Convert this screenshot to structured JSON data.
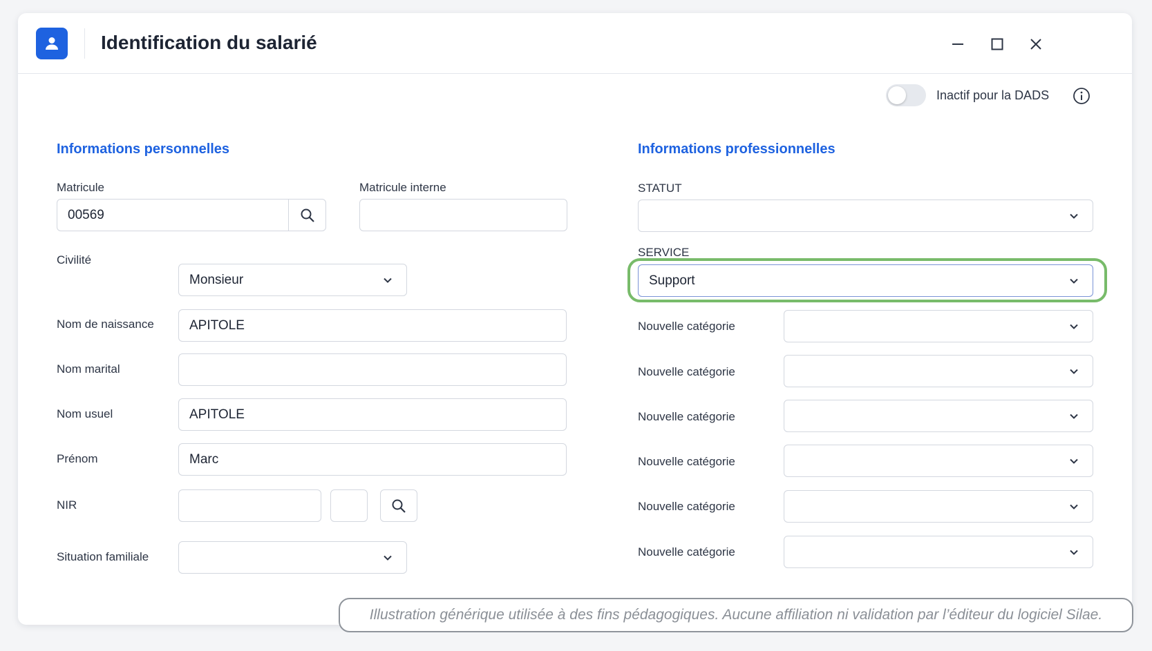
{
  "window": {
    "title": "Identification du salarié",
    "app_icon": "user-icon",
    "controls": [
      "minimize-icon",
      "maximize-icon",
      "close-icon"
    ]
  },
  "dads_toggle": {
    "label": "Inactif pour la DADS",
    "on": false,
    "info_icon": "info-icon"
  },
  "personal": {
    "title": "Informations personnelles",
    "matricule": {
      "label": "Matricule",
      "value": "00569"
    },
    "matricule_interne": {
      "label": "Matricule interne",
      "value": ""
    },
    "civilite": {
      "label": "Civilité",
      "value": "Monsieur"
    },
    "nom_naissance": {
      "label": "Nom de naissance",
      "value": "APITOLE"
    },
    "nom_marital": {
      "label": "Nom marital",
      "value": ""
    },
    "nom_usuel": {
      "label": "Nom usuel",
      "value": "APITOLE"
    },
    "prenom": {
      "label": "Prénom",
      "value": "Marc"
    },
    "nir": {
      "label": "NIR",
      "value": "",
      "key": ""
    },
    "situation_familiale": {
      "label": "Situation familiale",
      "value": ""
    }
  },
  "professional": {
    "title": "Informations professionnelles",
    "statut": {
      "label": "STATUT",
      "value": ""
    },
    "service": {
      "label": "SERVICE",
      "value": "Support"
    },
    "categories": [
      {
        "label": "Nouvelle catégorie",
        "value": ""
      },
      {
        "label": "Nouvelle catégorie",
        "value": ""
      },
      {
        "label": "Nouvelle catégorie",
        "value": ""
      },
      {
        "label": "Nouvelle catégorie",
        "value": ""
      },
      {
        "label": "Nouvelle catégorie",
        "value": ""
      },
      {
        "label": "Nouvelle catégorie",
        "value": ""
      }
    ]
  },
  "disclaimer": "Illustration générique utilisée à des fins pédagogiques. Aucune affiliation ni validation par l’éditeur du logiciel Silae.",
  "colors": {
    "accent": "#1e62e0",
    "highlight": "#78bb6a",
    "border": "#d3d7df"
  }
}
